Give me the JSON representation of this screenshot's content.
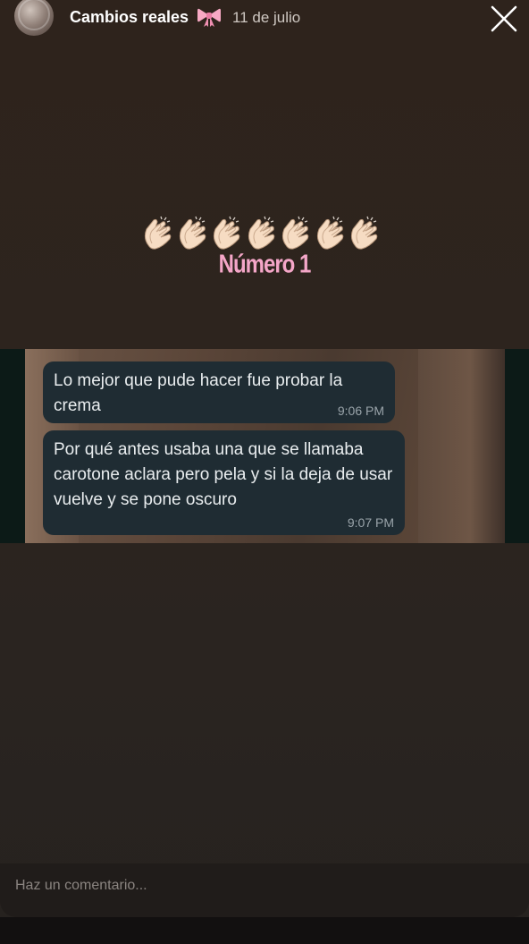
{
  "header": {
    "username": "Cambios reales",
    "bow_icon": "ribbon-bow-icon",
    "date": "11 de julio",
    "close_icon": "close-icon"
  },
  "story": {
    "clap_icon": "clapping-hands-icon",
    "clap_count": 7,
    "headline": "Número 1"
  },
  "chat": {
    "messages": [
      {
        "text": "Lo mejor que pude hacer fue probar la crema",
        "time": "9:06 PM"
      },
      {
        "text": "Por qué antes usaba una que se llamaba carotone aclara pero pela y si la deja de usar vuelve y se pone oscuro",
        "time": "9:07 PM"
      }
    ]
  },
  "comment": {
    "placeholder": "Haz un comentario..."
  },
  "colors": {
    "headline": "#f4a6c8",
    "bubble": "#1f2c33",
    "background": "#2d241e"
  }
}
